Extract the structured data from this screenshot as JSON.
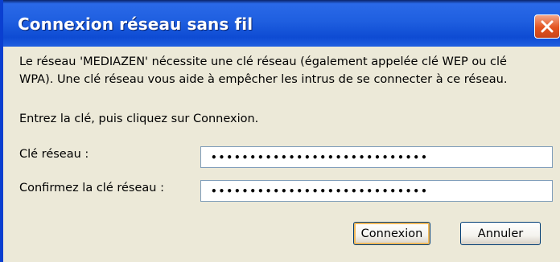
{
  "window": {
    "title": "Connexion réseau sans fil"
  },
  "dialog": {
    "message": "Le réseau 'MEDIAZEN' nécessite une clé réseau (également appelée clé WEP ou clé WPA). Une clé réseau vous aide à empêcher les intrus de se connecter à ce réseau.",
    "instruction": "Entrez la clé, puis cliquez sur Connexion.",
    "key_label": "Clé réseau :",
    "key_value": "••••••••••••••••••••••••••••",
    "confirm_label": "Confirmez la clé réseau :",
    "confirm_value": "••••••••••••••••••••••••••••"
  },
  "buttons": {
    "connect": "Connexion",
    "cancel": "Annuler"
  },
  "icons": {
    "close": "close-icon"
  },
  "colors": {
    "titlebar": "#0e4bd3",
    "close_button": "#e3531f",
    "background": "#ece9d8"
  }
}
